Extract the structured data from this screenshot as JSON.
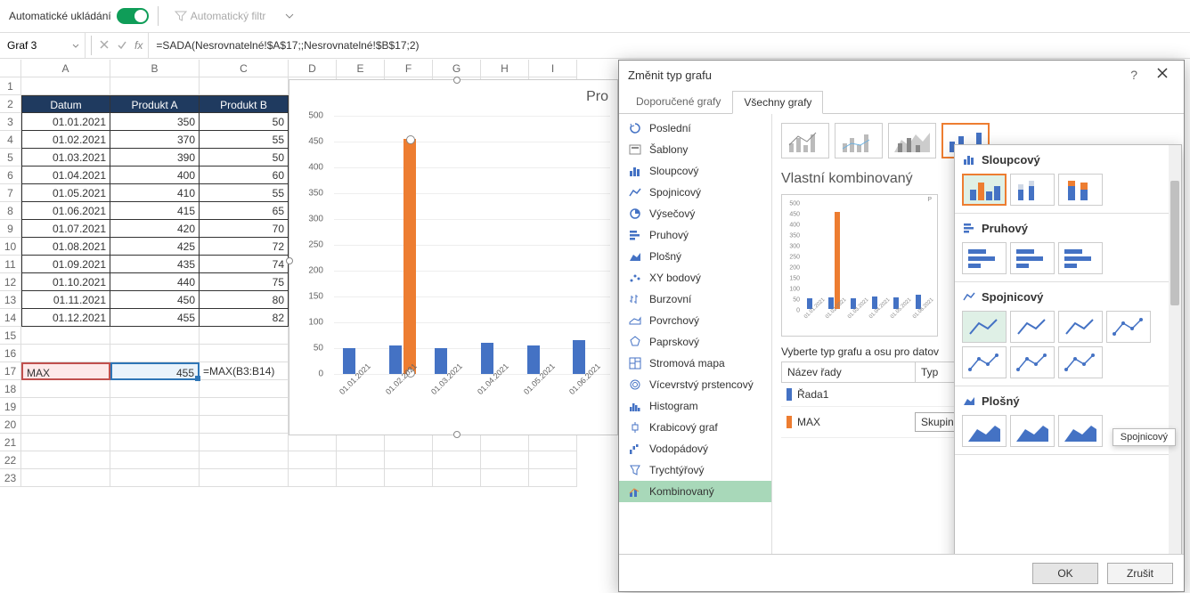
{
  "ribbon": {
    "autosave_label": "Automatické ukládání",
    "autofilter_label": "Automatický filtr"
  },
  "formula_bar": {
    "name_box": "Graf 3",
    "formula": "=SADA(Nesrovnatelné!$A$17;;Nesrovnatelné!$B$17;2)"
  },
  "columns": [
    "A",
    "B",
    "C",
    "D",
    "E",
    "F",
    "G",
    "H",
    "I"
  ],
  "table": {
    "headers": [
      "Datum",
      "Produkt A",
      "Produkt B"
    ],
    "rows": [
      [
        "01.01.2021",
        "350",
        "50"
      ],
      [
        "01.02.2021",
        "370",
        "55"
      ],
      [
        "01.03.2021",
        "390",
        "50"
      ],
      [
        "01.04.2021",
        "400",
        "60"
      ],
      [
        "01.05.2021",
        "410",
        "55"
      ],
      [
        "01.06.2021",
        "415",
        "65"
      ],
      [
        "01.07.2021",
        "420",
        "70"
      ],
      [
        "01.08.2021",
        "425",
        "72"
      ],
      [
        "01.09.2021",
        "435",
        "74"
      ],
      [
        "01.10.2021",
        "440",
        "75"
      ],
      [
        "01.11.2021",
        "450",
        "80"
      ],
      [
        "01.12.2021",
        "455",
        "82"
      ]
    ],
    "max_row": {
      "label": "MAX",
      "value": "455",
      "formula": "=MAX(B3:B14)"
    }
  },
  "chart_data": {
    "type": "bar",
    "categories": [
      "01.01.2021",
      "01.02.2021",
      "01.03.2021",
      "01.04.2021",
      "01.05.2021",
      "01.06.2021"
    ],
    "series": [
      {
        "name": "Řada1",
        "values": [
          50,
          55,
          50,
          60,
          55,
          65
        ],
        "color": "#4472c4"
      },
      {
        "name": "MAX",
        "values": [
          0,
          455,
          0,
          0,
          0,
          0
        ],
        "color": "#ed7d31"
      }
    ],
    "ylim": [
      0,
      500
    ],
    "yticks": [
      0,
      50,
      100,
      150,
      200,
      250,
      300,
      350,
      400,
      450,
      500
    ],
    "title_cut": "Pro"
  },
  "dialog": {
    "title": "Změnit typ grafu",
    "tabs": [
      "Doporučené grafy",
      "Všechny grafy"
    ],
    "active_tab": 1,
    "categories": [
      {
        "icon": "recent",
        "label": "Poslední"
      },
      {
        "icon": "template",
        "label": "Šablony"
      },
      {
        "icon": "column",
        "label": "Sloupcový"
      },
      {
        "icon": "line",
        "label": "Spojnicový"
      },
      {
        "icon": "pie",
        "label": "Výsečový"
      },
      {
        "icon": "bar",
        "label": "Pruhový"
      },
      {
        "icon": "area",
        "label": "Plošný"
      },
      {
        "icon": "scatter",
        "label": "XY bodový"
      },
      {
        "icon": "stock",
        "label": "Burzovní"
      },
      {
        "icon": "surface",
        "label": "Povrchový"
      },
      {
        "icon": "radar",
        "label": "Paprskový"
      },
      {
        "icon": "treemap",
        "label": "Stromová mapa"
      },
      {
        "icon": "sunburst",
        "label": "Vícevrstvý prstencový"
      },
      {
        "icon": "histogram",
        "label": "Histogram"
      },
      {
        "icon": "box",
        "label": "Krabicový graf"
      },
      {
        "icon": "waterfall",
        "label": "Vodopádový"
      },
      {
        "icon": "funnel",
        "label": "Trychtýřový"
      },
      {
        "icon": "combo",
        "label": "Kombinovaný"
      }
    ],
    "selected_category": 17,
    "preview_title": "Vlastní kombinovaný",
    "mini_yticks": [
      "0",
      "50",
      "100",
      "150",
      "200",
      "250",
      "300",
      "350",
      "400",
      "450",
      "500"
    ],
    "mini_xlabels": [
      "01.01.2021",
      "01.02.2021",
      "01.03.2021",
      "01.04.2021",
      "01.05.2021",
      "01.06.2021"
    ],
    "series_section_label": "Vyberte typ grafu a osu pro datov",
    "series_headers": [
      "Název řady",
      "Typ"
    ],
    "series_rows": [
      {
        "swatch": "#4472c4",
        "name": "Řada1",
        "type": ""
      },
      {
        "swatch": "#ed7d31",
        "name": "MAX",
        "type": "Skupinový sloupcový"
      }
    ],
    "buttons": {
      "ok": "OK",
      "cancel": "Zrušit"
    }
  },
  "flyout": {
    "sections": [
      {
        "title": "Sloupcový",
        "icon": "column"
      },
      {
        "title": "Pruhový",
        "icon": "bar"
      },
      {
        "title": "Spojnicový",
        "icon": "line"
      },
      {
        "title": "Plošný",
        "icon": "area"
      }
    ],
    "tooltip": "Spojnicový"
  }
}
